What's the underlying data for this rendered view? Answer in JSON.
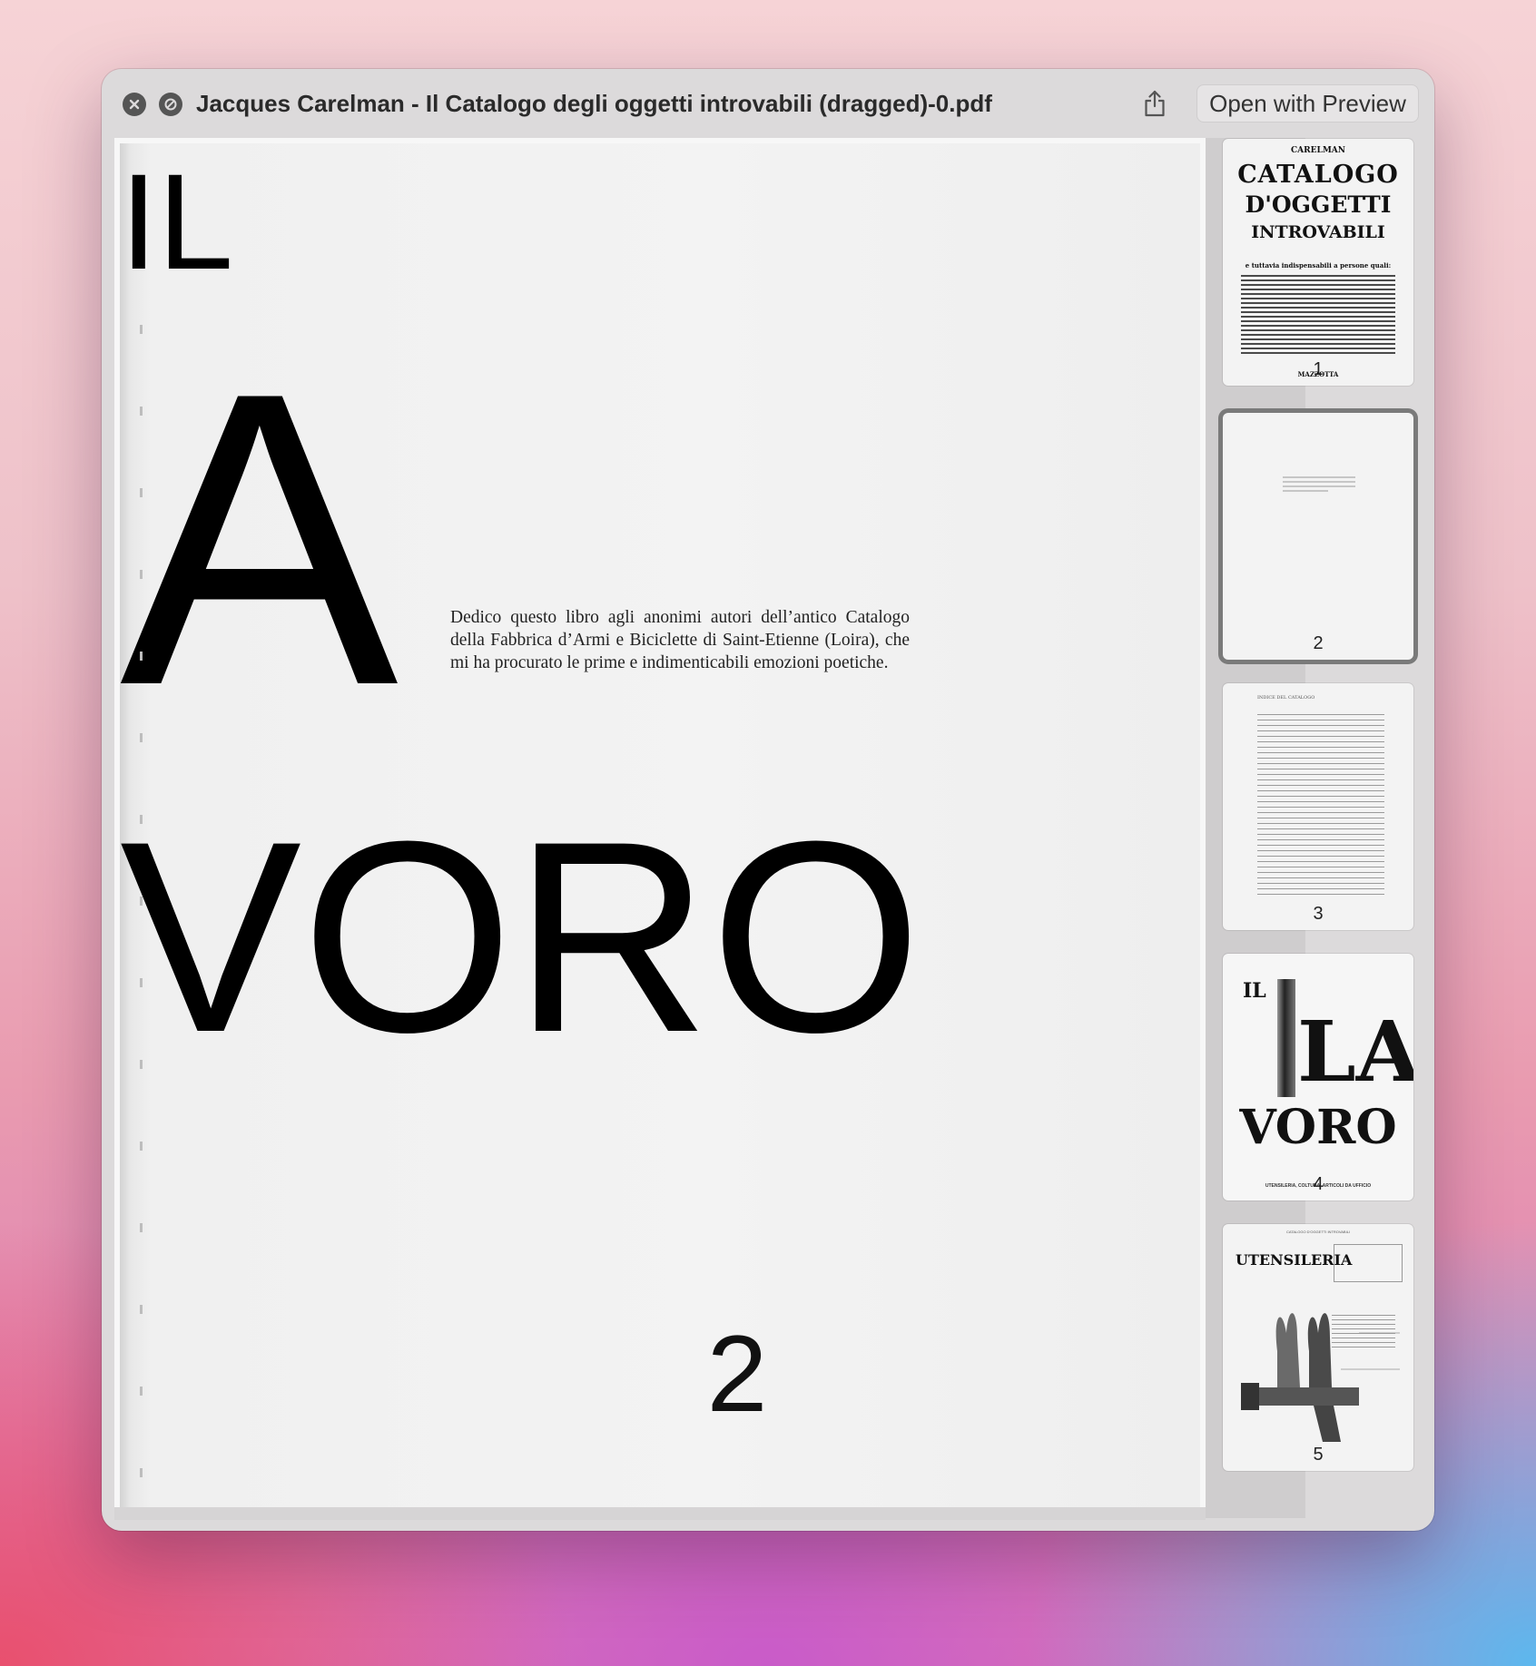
{
  "window": {
    "title": "Jacques Carelman - Il Catalogo degli oggetti introvabili (dragged)-0.pdf",
    "open_with_label": "Open with Preview"
  },
  "page": {
    "dedication": "Dedico questo libro agli anonimi autori dell’antico Catalogo della Fabbrica d’Armi e Biciclette di Saint-Etienne (Loira), che mi ha procurato le prime e indimenticabili emozioni poetiche.",
    "number": "2"
  },
  "thumbnails": [
    {
      "label": "1",
      "top": "CARELMAN",
      "line1": "CATALOGO",
      "line2": "D'OGGETTI",
      "line3": "INTROVABILI",
      "subtitle": "e tuttavia indispensabili a persone quali:",
      "publisher": "MAZZOTTA",
      "selected": false
    },
    {
      "label": "2",
      "selected": true
    },
    {
      "label": "3",
      "heading": "INDICE DEL CATALOGO",
      "selected": false
    },
    {
      "label": "4",
      "line1": "IL",
      "line2": "LA",
      "line3": "VORO",
      "caption": "UTENSILERIA, COLTURA, ARTICOLI DA UFFICIO",
      "selected": false
    },
    {
      "label": "5",
      "heading": "UTENSILERIA",
      "header": "CATALOGO D'OGGETTI INTROVABILI",
      "selected": false
    }
  ],
  "colors": {
    "accent_selected": "#7a7a7a",
    "window_bg": "#dcdadb"
  },
  "icons": [
    "close-icon",
    "block-icon",
    "share-icon"
  ]
}
